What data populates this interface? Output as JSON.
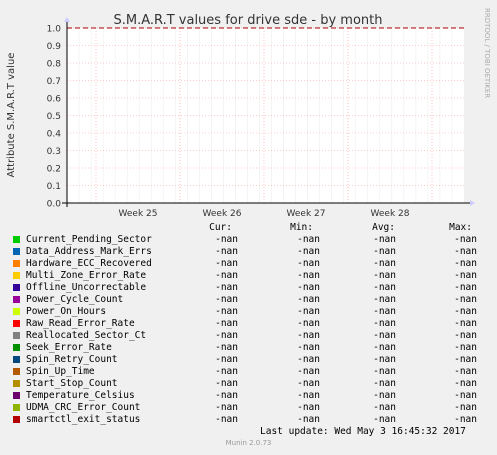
{
  "chart_data": {
    "type": "line",
    "title": "S.M.A.R.T values for drive sde - by month",
    "ylabel": "Attribute S.M.A.R.T value",
    "watermark": "RRDTOOL / TOBI OETIKER",
    "x_ticks": [
      "Week 25",
      "Week 26",
      "Week 27",
      "Week 28"
    ],
    "y_ticks": [
      "0.0",
      "0.1",
      "0.2",
      "0.3",
      "0.4",
      "0.5",
      "0.6",
      "0.7",
      "0.8",
      "0.9",
      "1.0"
    ],
    "ylim": [
      0,
      1
    ],
    "threshold": 1.0,
    "grid": true,
    "series": [
      {
        "name": "Current_Pending_Sector",
        "color": "#00cc00",
        "cur": "-nan",
        "min": "-nan",
        "avg": "-nan",
        "max": "-nan"
      },
      {
        "name": "Data_Address_Mark_Errs",
        "color": "#0066b3",
        "cur": "-nan",
        "min": "-nan",
        "avg": "-nan",
        "max": "-nan"
      },
      {
        "name": "Hardware_ECC_Recovered",
        "color": "#ff8000",
        "cur": "-nan",
        "min": "-nan",
        "avg": "-nan",
        "max": "-nan"
      },
      {
        "name": "Multi_Zone_Error_Rate",
        "color": "#ffcc00",
        "cur": "-nan",
        "min": "-nan",
        "avg": "-nan",
        "max": "-nan"
      },
      {
        "name": "Offline_Uncorrectable",
        "color": "#330099",
        "cur": "-nan",
        "min": "-nan",
        "avg": "-nan",
        "max": "-nan"
      },
      {
        "name": "Power_Cycle_Count",
        "color": "#990099",
        "cur": "-nan",
        "min": "-nan",
        "avg": "-nan",
        "max": "-nan"
      },
      {
        "name": "Power_On_Hours",
        "color": "#ccff00",
        "cur": "-nan",
        "min": "-nan",
        "avg": "-nan",
        "max": "-nan"
      },
      {
        "name": "Raw_Read_Error_Rate",
        "color": "#ff0000",
        "cur": "-nan",
        "min": "-nan",
        "avg": "-nan",
        "max": "-nan"
      },
      {
        "name": "Reallocated_Sector_Ct",
        "color": "#808080",
        "cur": "-nan",
        "min": "-nan",
        "avg": "-nan",
        "max": "-nan"
      },
      {
        "name": "Seek_Error_Rate",
        "color": "#008f00",
        "cur": "-nan",
        "min": "-nan",
        "avg": "-nan",
        "max": "-nan"
      },
      {
        "name": "Spin_Retry_Count",
        "color": "#00487d",
        "cur": "-nan",
        "min": "-nan",
        "avg": "-nan",
        "max": "-nan"
      },
      {
        "name": "Spin_Up_Time",
        "color": "#b35a00",
        "cur": "-nan",
        "min": "-nan",
        "avg": "-nan",
        "max": "-nan"
      },
      {
        "name": "Start_Stop_Count",
        "color": "#b38f00",
        "cur": "-nan",
        "min": "-nan",
        "avg": "-nan",
        "max": "-nan"
      },
      {
        "name": "Temperature_Celsius",
        "color": "#6b006b",
        "cur": "-nan",
        "min": "-nan",
        "avg": "-nan",
        "max": "-nan"
      },
      {
        "name": "UDMA_CRC_Error_Count",
        "color": "#8fb300",
        "cur": "-nan",
        "min": "-nan",
        "avg": "-nan",
        "max": "-nan"
      },
      {
        "name": "smartctl_exit_status",
        "color": "#b30000",
        "cur": "-nan",
        "min": "-nan",
        "avg": "-nan",
        "max": "-nan"
      }
    ]
  },
  "legend_headers": {
    "cur": "Cur:",
    "min": "Min:",
    "avg": "Avg:",
    "max": "Max:"
  },
  "last_update": "Last update: Wed May  3 16:45:32 2017",
  "footer": "Munin 2.0.73"
}
